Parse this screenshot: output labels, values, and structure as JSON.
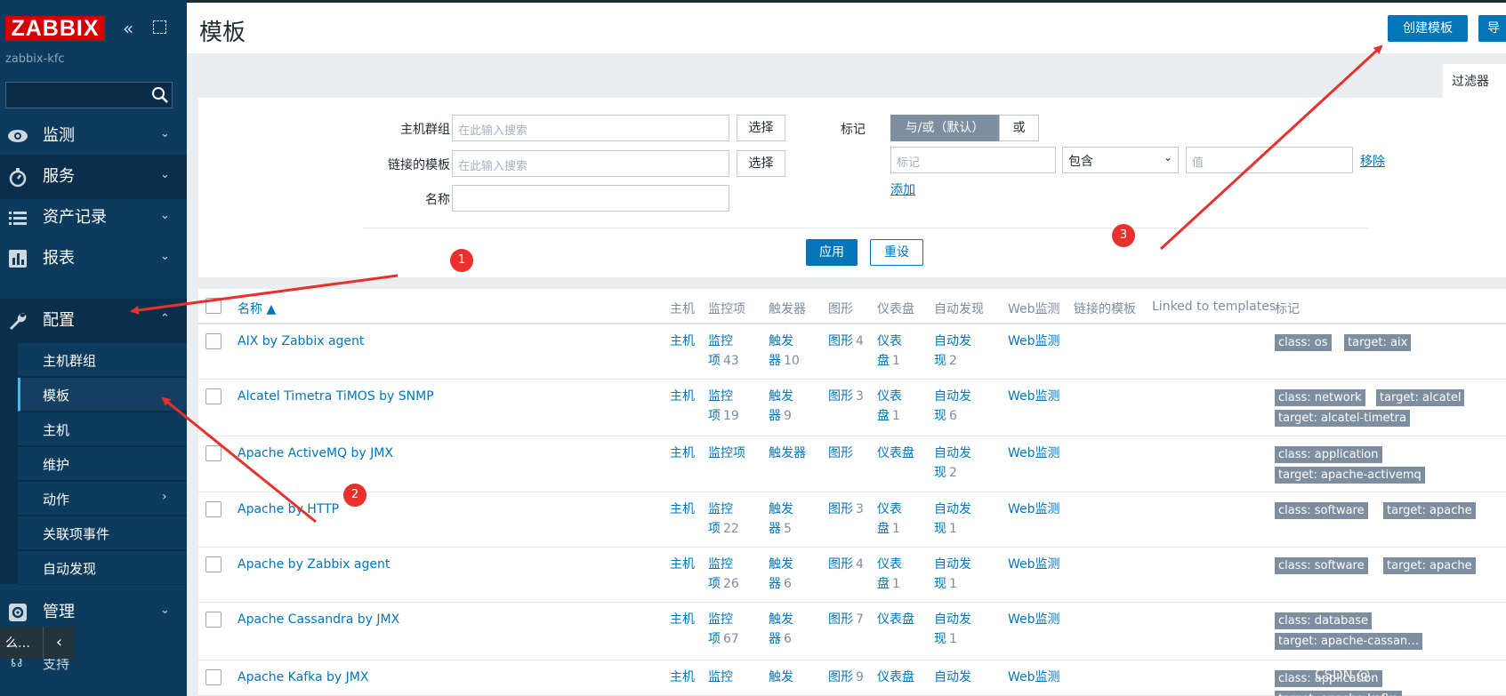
{
  "sidebar": {
    "logo": "ZABBIX",
    "server_name": "zabbix-kfc",
    "menu": [
      {
        "label": "监测",
        "icon": "eye-icon"
      },
      {
        "label": "服务",
        "icon": "stopwatch-icon"
      },
      {
        "label": "资产记录",
        "icon": "list-icon"
      },
      {
        "label": "报表",
        "icon": "bar-chart-icon"
      },
      {
        "label": "配置",
        "icon": "wrench-icon"
      },
      {
        "label": "管理",
        "icon": "gear-icon"
      }
    ],
    "submenu": [
      "主机群组",
      "模板",
      "主机",
      "维护",
      "动作",
      "关联项事件",
      "自动发现"
    ],
    "bottom_text": "么…",
    "support": "支持"
  },
  "header": {
    "title": "模板",
    "create_button": "创建模板",
    "import_button": "导"
  },
  "filter": {
    "tab": "过滤器",
    "host_groups_label": "主机群组",
    "linked_templates_label": "链接的模板",
    "name_label": "名称",
    "search_placeholder": "在此输入搜索",
    "select_button": "选择",
    "tags_label": "标记",
    "and_or": "与/或（默认）",
    "or": "或",
    "tag_placeholder": "标记",
    "operator": "包含",
    "value_placeholder": "值",
    "remove": "移除",
    "add": "添加",
    "apply": "应用",
    "reset": "重设"
  },
  "table": {
    "columns": [
      "名称 ▲",
      "主机",
      "监控项",
      "触发器",
      "图形",
      "仪表盘",
      "自动发现",
      "Web监测",
      "链接的模板",
      "Linked to templates",
      "标记"
    ],
    "rows": [
      {
        "name": "AIX by Zabbix agent",
        "hosts": "主机",
        "items_a": "监控",
        "items_b": "项",
        "items_n": "43",
        "triggers_a": "触发",
        "triggers_b": "器",
        "triggers_n": "10",
        "graphs": "图形",
        "graphs_n": "4",
        "dash_a": "仪表",
        "dash_b": "盘",
        "dash_n": "1",
        "disc_a": "自动发",
        "disc_b": "现",
        "disc_n": "2",
        "web": "Web监测",
        "tags": [
          "class: os",
          "target: aix"
        ]
      },
      {
        "name": "Alcatel Timetra TiMOS by SNMP",
        "hosts": "主机",
        "items_a": "监控",
        "items_b": "项",
        "items_n": "19",
        "triggers_a": "触发",
        "triggers_b": "器",
        "triggers_n": "9",
        "graphs": "图形",
        "graphs_n": "3",
        "dash_a": "仪表",
        "dash_b": "盘",
        "dash_n": "1",
        "disc_a": "自动发",
        "disc_b": "现",
        "disc_n": "6",
        "web": "Web监测",
        "tags": [
          "class: network",
          "target: alcatel",
          "target: alcatel-timetra"
        ]
      },
      {
        "name": "Apache ActiveMQ by JMX",
        "hosts": "主机",
        "items_a": "监控项",
        "items_b": "",
        "items_n": "",
        "triggers_a": "触发器",
        "triggers_b": "",
        "triggers_n": "",
        "graphs": "图形",
        "graphs_n": "",
        "dash_a": "仪表盘",
        "dash_b": "",
        "dash_n": "",
        "disc_a": "自动发",
        "disc_b": "现",
        "disc_n": "2",
        "web": "Web监测",
        "tags": [
          "class: application",
          "target: apache-activemq"
        ]
      },
      {
        "name": "Apache by HTTP",
        "hosts": "主机",
        "items_a": "监控",
        "items_b": "项",
        "items_n": "22",
        "triggers_a": "触发",
        "triggers_b": "器",
        "triggers_n": "5",
        "graphs": "图形",
        "graphs_n": "3",
        "dash_a": "仪表",
        "dash_b": "盘",
        "dash_n": "1",
        "disc_a": "自动发",
        "disc_b": "现",
        "disc_n": "1",
        "web": "Web监测",
        "tags": [
          "class: software",
          "target: apache"
        ]
      },
      {
        "name": "Apache by Zabbix agent",
        "hosts": "主机",
        "items_a": "监控",
        "items_b": "项",
        "items_n": "26",
        "triggers_a": "触发",
        "triggers_b": "器",
        "triggers_n": "6",
        "graphs": "图形",
        "graphs_n": "4",
        "dash_a": "仪表",
        "dash_b": "盘",
        "dash_n": "1",
        "disc_a": "自动发",
        "disc_b": "现",
        "disc_n": "1",
        "web": "Web监测",
        "tags": [
          "class: software",
          "target: apache"
        ]
      },
      {
        "name": "Apache Cassandra by JMX",
        "hosts": "主机",
        "items_a": "监控",
        "items_b": "项",
        "items_n": "67",
        "triggers_a": "触发",
        "triggers_b": "器",
        "triggers_n": "6",
        "graphs": "图形",
        "graphs_n": "7",
        "dash_a": "仪表盘",
        "dash_b": "",
        "dash_n": "",
        "disc_a": "自动发",
        "disc_b": "现",
        "disc_n": "1",
        "web": "Web监测",
        "tags": [
          "class: database",
          "target: apache-cassan…"
        ]
      },
      {
        "name": "Apache Kafka by JMX",
        "hosts": "主机",
        "items_a": "监控",
        "items_b": "",
        "items_n": "",
        "triggers_a": "触发",
        "triggers_b": "",
        "triggers_n": "",
        "graphs": "图形",
        "graphs_n": "9",
        "dash_a": "仪表盘",
        "dash_b": "",
        "dash_n": "",
        "disc_a": "自动发",
        "disc_b": "",
        "disc_n": "",
        "web": "Web监测",
        "tags": [
          "class: application",
          "target: apache-kafka"
        ]
      }
    ]
  },
  "annotations": {
    "markers": [
      "1",
      "2",
      "3"
    ],
    "color": "#e8302c",
    "watermark": "CSDN @"
  }
}
